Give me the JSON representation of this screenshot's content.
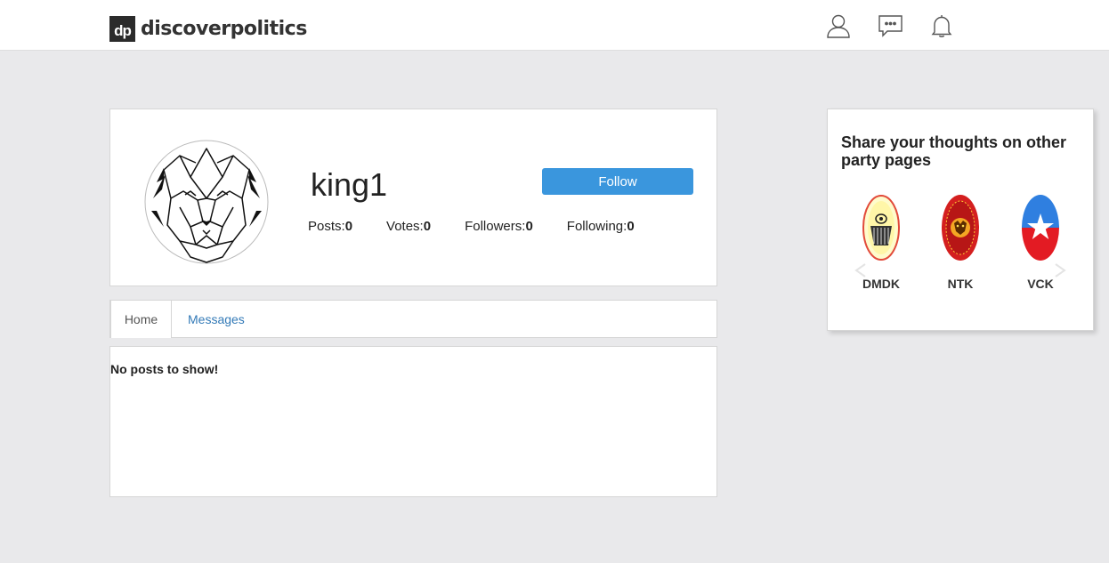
{
  "header": {
    "logo_mark": "dp",
    "logo_text": "discoverpolitics"
  },
  "profile": {
    "username": "king1",
    "follow_label": "Follow",
    "stats": [
      {
        "label": "Posts:",
        "value": "0"
      },
      {
        "label": "Votes:",
        "value": "0"
      },
      {
        "label": "Followers:",
        "value": "0"
      },
      {
        "label": "Following:",
        "value": "0"
      }
    ]
  },
  "tabs": {
    "home": "Home",
    "messages": "Messages"
  },
  "posts": {
    "empty_message": "No posts to show!"
  },
  "sidebar": {
    "title": "Share your thoughts on other party pages",
    "parties": [
      {
        "label": "DMDK"
      },
      {
        "label": "NTK"
      },
      {
        "label": "VCK"
      }
    ]
  },
  "colors": {
    "accent": "#3a96dd",
    "link": "#337ab7",
    "background": "#e9e9eb"
  }
}
